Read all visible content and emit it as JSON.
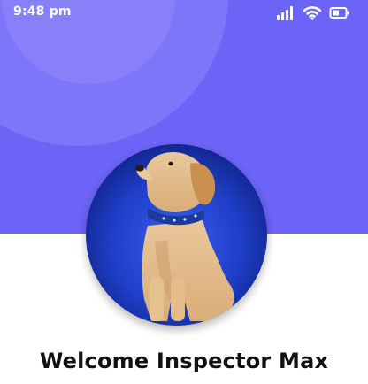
{
  "status_bar": {
    "time": "9:48 pm",
    "icons": [
      "signal-icon",
      "wifi-icon",
      "battery-icon"
    ]
  },
  "header": {
    "background_color": "#6c63f7"
  },
  "profile": {
    "avatar": "dog-photo",
    "welcome_text": "Welcome Inspector Max"
  }
}
